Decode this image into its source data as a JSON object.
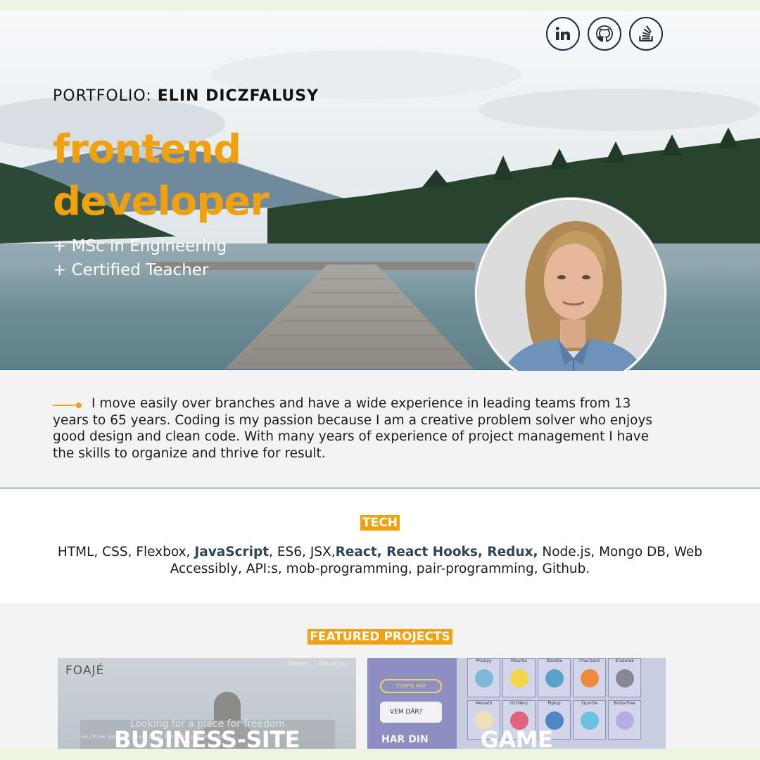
{
  "social": {
    "linkedin_icon": "linkedin-icon",
    "github_icon": "github-icon",
    "stackoverflow_icon": "stackoverflow-icon"
  },
  "hero": {
    "prefix": "PORTFOLIO: ",
    "name": "ELIN DICZFALUSY",
    "role_line1": "frontend",
    "role_line2": "developer",
    "degree1": "+ MSc in Engineering",
    "degree2": "+ Certified Teacher"
  },
  "about": {
    "text": "I move easily over branches and have a wide experience in leading teams from 13 years to 65 years. Coding is my passion because I am a creative problem solver who enjoys good design and clean code. With many years of experience of project management I have the skills to organize and thrive for result."
  },
  "tech": {
    "tag": "TECH",
    "part1": "HTML, CSS, Flexbox, ",
    "bold1": "JavaScript",
    "part2": ", ES6, JSX,",
    "bold2": "React, React Hooks, Redux,",
    "part3": " Node.js, Mongo DB, Web Accessibly, API:s, mob-programming, pair-programming, Github."
  },
  "projects": {
    "tag": "FEATURED PROJECTS",
    "cards": [
      {
        "title": "BUSINESS-SITE",
        "logo": "FOAJÉ",
        "nav": [
          "Stories",
          "About us"
        ],
        "headline": "Looking for a place for freedom",
        "body": "So did we. Join our ... each other, but with a platform and an ..."
      },
      {
        "title": "GAME",
        "start_button": "STARTA HÄR",
        "bubble": "VEM DÄR?",
        "heading": "HAR DIN",
        "pokemon": [
          "Phanpy",
          "Pikachu",
          "Totodile",
          "Charizard",
          "Krokorok",
          "Meowth",
          "Octillery",
          "Piplup",
          "Squirtle",
          "Butterfree"
        ]
      }
    ]
  },
  "colors": {
    "accent": "#f0a10d",
    "dark": "#1c2d3b",
    "divider": "#2d6aa8"
  }
}
